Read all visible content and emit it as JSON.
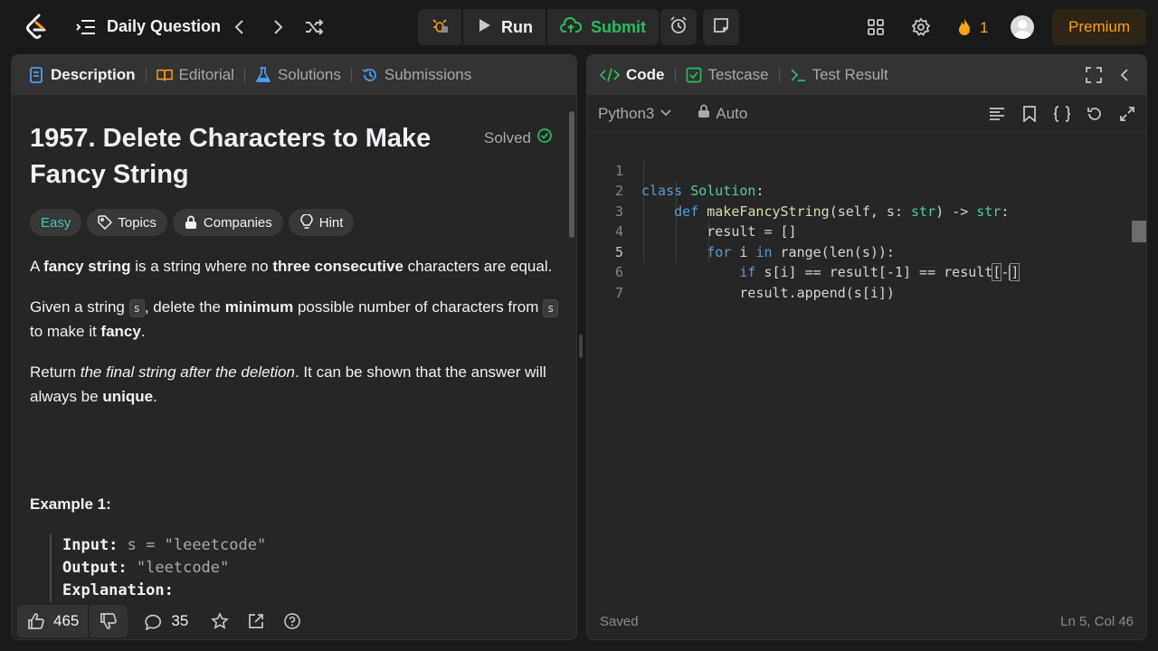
{
  "topbar": {
    "title": "Daily Question",
    "run_label": "Run",
    "submit_label": "Submit",
    "streak_count": "1",
    "premium_label": "Premium"
  },
  "left": {
    "tabs": [
      {
        "label": "Description"
      },
      {
        "label": "Editorial"
      },
      {
        "label": "Solutions"
      },
      {
        "label": "Submissions"
      }
    ],
    "problem_title": "1957. Delete Characters to Make Fancy String",
    "solved_label": "Solved",
    "chips": {
      "difficulty": "Easy",
      "topics": "Topics",
      "companies": "Companies",
      "hint": "Hint"
    },
    "p1": {
      "t1": "A ",
      "b1": "fancy string",
      "t2": " is a string where no ",
      "b2": "three consecutive",
      "t3": " characters are equal."
    },
    "p2": {
      "t1": "Given a string ",
      "c1": "s",
      "t2": ", delete the ",
      "b1": "minimum",
      "t3": " possible number of characters from ",
      "c2": "s",
      "t4": " to make it ",
      "b2": "fancy",
      "t5": "."
    },
    "p3": {
      "t1": "Return ",
      "i1": "the final string after the deletion",
      "t2": ". It can be shown that the answer will always be ",
      "b1": "unique",
      "t3": "."
    },
    "example_title": "Example 1:",
    "example": {
      "input_label": "Input:",
      "input_value": "s = \"leeetcode\"",
      "output_label": "Output:",
      "output_value": "\"leetcode\"",
      "explanation_label": "Explanation:"
    },
    "likes": "465",
    "comments": "35"
  },
  "right": {
    "tabs": [
      {
        "label": "Code"
      },
      {
        "label": "Testcase"
      },
      {
        "label": "Test Result"
      }
    ],
    "language": "Python3",
    "mode": "Auto",
    "code_lines": [
      {
        "n": "1"
      },
      {
        "n": "2"
      },
      {
        "n": "3"
      },
      {
        "n": "4"
      },
      {
        "n": "5"
      },
      {
        "n": "6"
      },
      {
        "n": "7"
      }
    ],
    "code": {
      "l1_kw": "class",
      "l1_cls": "Solution",
      "l1_rest": ":",
      "l2_kw": "def",
      "l2_fn": "makeFancyString",
      "l2_args": "(self, s: ",
      "l2_type": "str",
      "l2_arrow": ") -> ",
      "l2_ret": "str",
      "l2_end": ":",
      "l3": "result = []",
      "l4_kw1": "for",
      "l4_mid": " i ",
      "l4_kw2": "in",
      "l4_rest": " range(len(s)):",
      "l5_kw": "if",
      "l5_rest": " s[i] == result[-1] == result",
      "l5_br": "[",
      "l5_tail": "-",
      "l5_close": "]",
      "l6": "result.append(s[i])"
    },
    "status_left": "Saved",
    "status_right": "Ln 5, Col 46"
  }
}
